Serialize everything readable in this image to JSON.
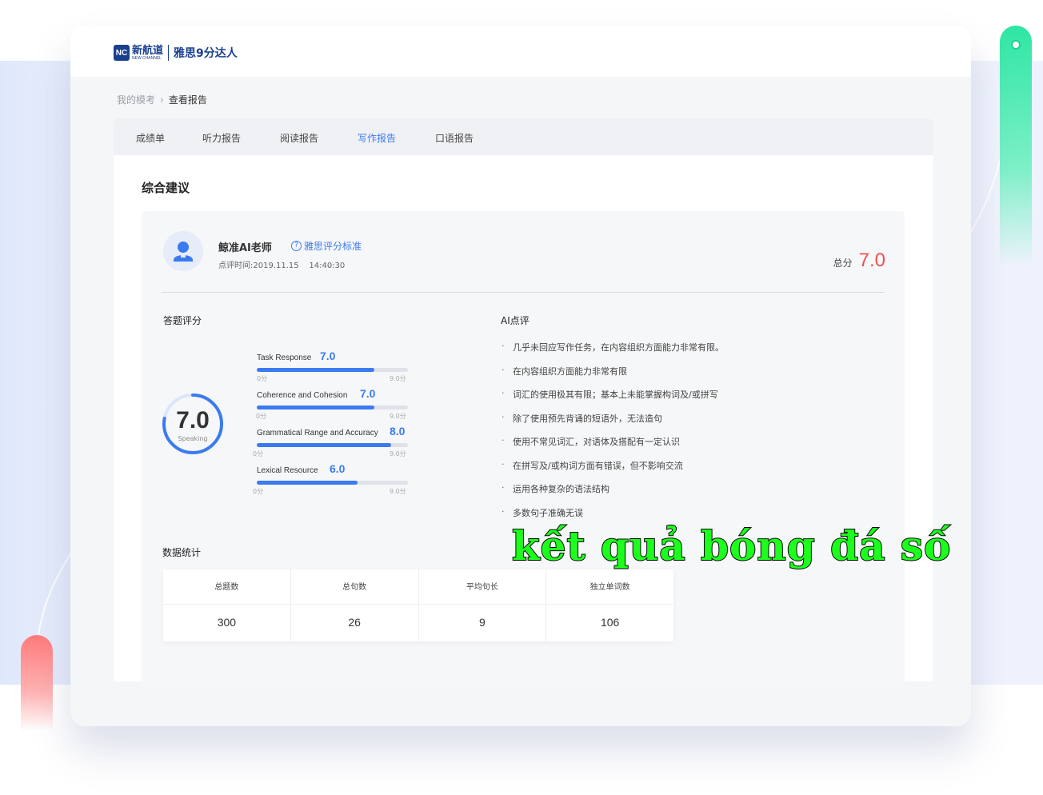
{
  "brand": {
    "logo_badge": "NC",
    "logo_cn": "新航道",
    "logo_en": "NEW CHANNEL",
    "slogan": "雅思9分达人",
    "color": "#1a3f8f"
  },
  "breadcrumb": {
    "parent": "我的模考",
    "current": "查看报告"
  },
  "tabs": [
    {
      "label": "成绩单",
      "active": false
    },
    {
      "label": "听力报告",
      "active": false
    },
    {
      "label": "阅读报告",
      "active": false
    },
    {
      "label": "写作报告",
      "active": true
    },
    {
      "label": "口语报告",
      "active": false
    }
  ],
  "section_title": "综合建议",
  "teacher": {
    "name": "鲸准AI老师",
    "standard_link": "雅思评分标准",
    "time_label": "点评时间:",
    "date": "2019.11.15",
    "time": "14:40:30"
  },
  "total": {
    "label": "总分",
    "value": "7.0"
  },
  "scoring": {
    "title": "答题评分",
    "overall": "7.0",
    "overall_label": "Speaking",
    "overall_fraction": 0.78,
    "criteria": [
      {
        "name": "Task Response",
        "score": "7.0",
        "value": 7.0,
        "min": "0分",
        "max": "9.0分"
      },
      {
        "name": "Coherence and Cohesion",
        "score": "7.0",
        "value": 7.0,
        "min": "0分",
        "max": "9.0分"
      },
      {
        "name": "Grammatical Range and Accuracy",
        "score": "8.0",
        "value": 8.0,
        "min": "0分",
        "max": "9.0分"
      },
      {
        "name": "Lexical Resource",
        "score": "6.0",
        "value": 6.0,
        "min": "0分",
        "max": "9.0分"
      }
    ],
    "max_value": 9.0
  },
  "ai_review": {
    "title": "AI点评",
    "items": [
      "几乎未回应写作任务，在内容组织方面能力非常有限。",
      "在内容组织方面能力非常有限",
      "词汇的使用极其有限；基本上未能掌握构词及/或拼写",
      "除了使用预先背诵的短语外，无法造句",
      "使用不常见词汇，对语体及搭配有一定认识",
      "在拼写及/或构词方面有错误，但不影响交流",
      "运用各种复杂的语法结构",
      "多数句子准确无误"
    ]
  },
  "stats": {
    "title": "数据统计",
    "columns": [
      {
        "label": "总题数",
        "value": "300"
      },
      {
        "label": "总句数",
        "value": "26"
      },
      {
        "label": "平均句长",
        "value": "9"
      },
      {
        "label": "独立单词数",
        "value": "106"
      }
    ]
  },
  "overlay_caption": "kết quả bóng đá số",
  "colors": {
    "accent": "#3b7bf0",
    "score_red": "#f05050",
    "overlay_green": "#1cff1c"
  }
}
